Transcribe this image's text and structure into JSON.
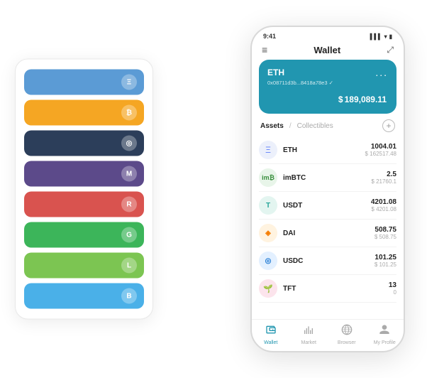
{
  "scene": {
    "cardStack": {
      "rows": [
        {
          "color": "blue",
          "iconText": "Ξ"
        },
        {
          "color": "yellow",
          "iconText": "₿"
        },
        {
          "color": "dark",
          "iconText": "◎"
        },
        {
          "color": "purple",
          "iconText": "M"
        },
        {
          "color": "red",
          "iconText": "R"
        },
        {
          "color": "green",
          "iconText": "G"
        },
        {
          "color": "ltgreen",
          "iconText": "L"
        },
        {
          "color": "ltblue",
          "iconText": "B"
        }
      ]
    },
    "phone": {
      "statusBar": {
        "time": "9:41",
        "icons": "▌▌▌ ▾ ▮"
      },
      "header": {
        "menuLabel": "≡",
        "title": "Wallet",
        "expandLabel": "⤢"
      },
      "ethCard": {
        "symbol": "ETH",
        "address": "0x08711d3b...8418a78e3 ✓",
        "dotsLabel": "...",
        "balancePrefix": "$",
        "balance": "189,089.11"
      },
      "assetsHeader": {
        "activeTab": "Assets",
        "separator": "/",
        "inactiveTab": "Collectibles",
        "addLabel": "+"
      },
      "assets": [
        {
          "name": "ETH",
          "amount": "1004.01",
          "usd": "$ 162517.48",
          "icon": "Ξ",
          "iconClass": "icon-eth"
        },
        {
          "name": "imBTC",
          "amount": "2.5",
          "usd": "$ 21760.1",
          "icon": "₿",
          "iconClass": "icon-imbtc"
        },
        {
          "name": "USDT",
          "amount": "4201.08",
          "usd": "$ 4201.08",
          "icon": "T",
          "iconClass": "icon-usdt"
        },
        {
          "name": "DAI",
          "amount": "508.75",
          "usd": "$ 508.75",
          "icon": "D",
          "iconClass": "icon-dai"
        },
        {
          "name": "USDC",
          "amount": "101.25",
          "usd": "$ 101.25",
          "icon": "◎",
          "iconClass": "icon-usdc"
        },
        {
          "name": "TFT",
          "amount": "13",
          "usd": "0",
          "icon": "🌱",
          "iconClass": "icon-tft"
        }
      ],
      "bottomNav": [
        {
          "label": "Wallet",
          "icon": "◎",
          "active": true
        },
        {
          "label": "Market",
          "icon": "📊",
          "active": false
        },
        {
          "label": "Browser",
          "icon": "👤",
          "active": false
        },
        {
          "label": "My Profile",
          "icon": "👤",
          "active": false
        }
      ]
    }
  }
}
